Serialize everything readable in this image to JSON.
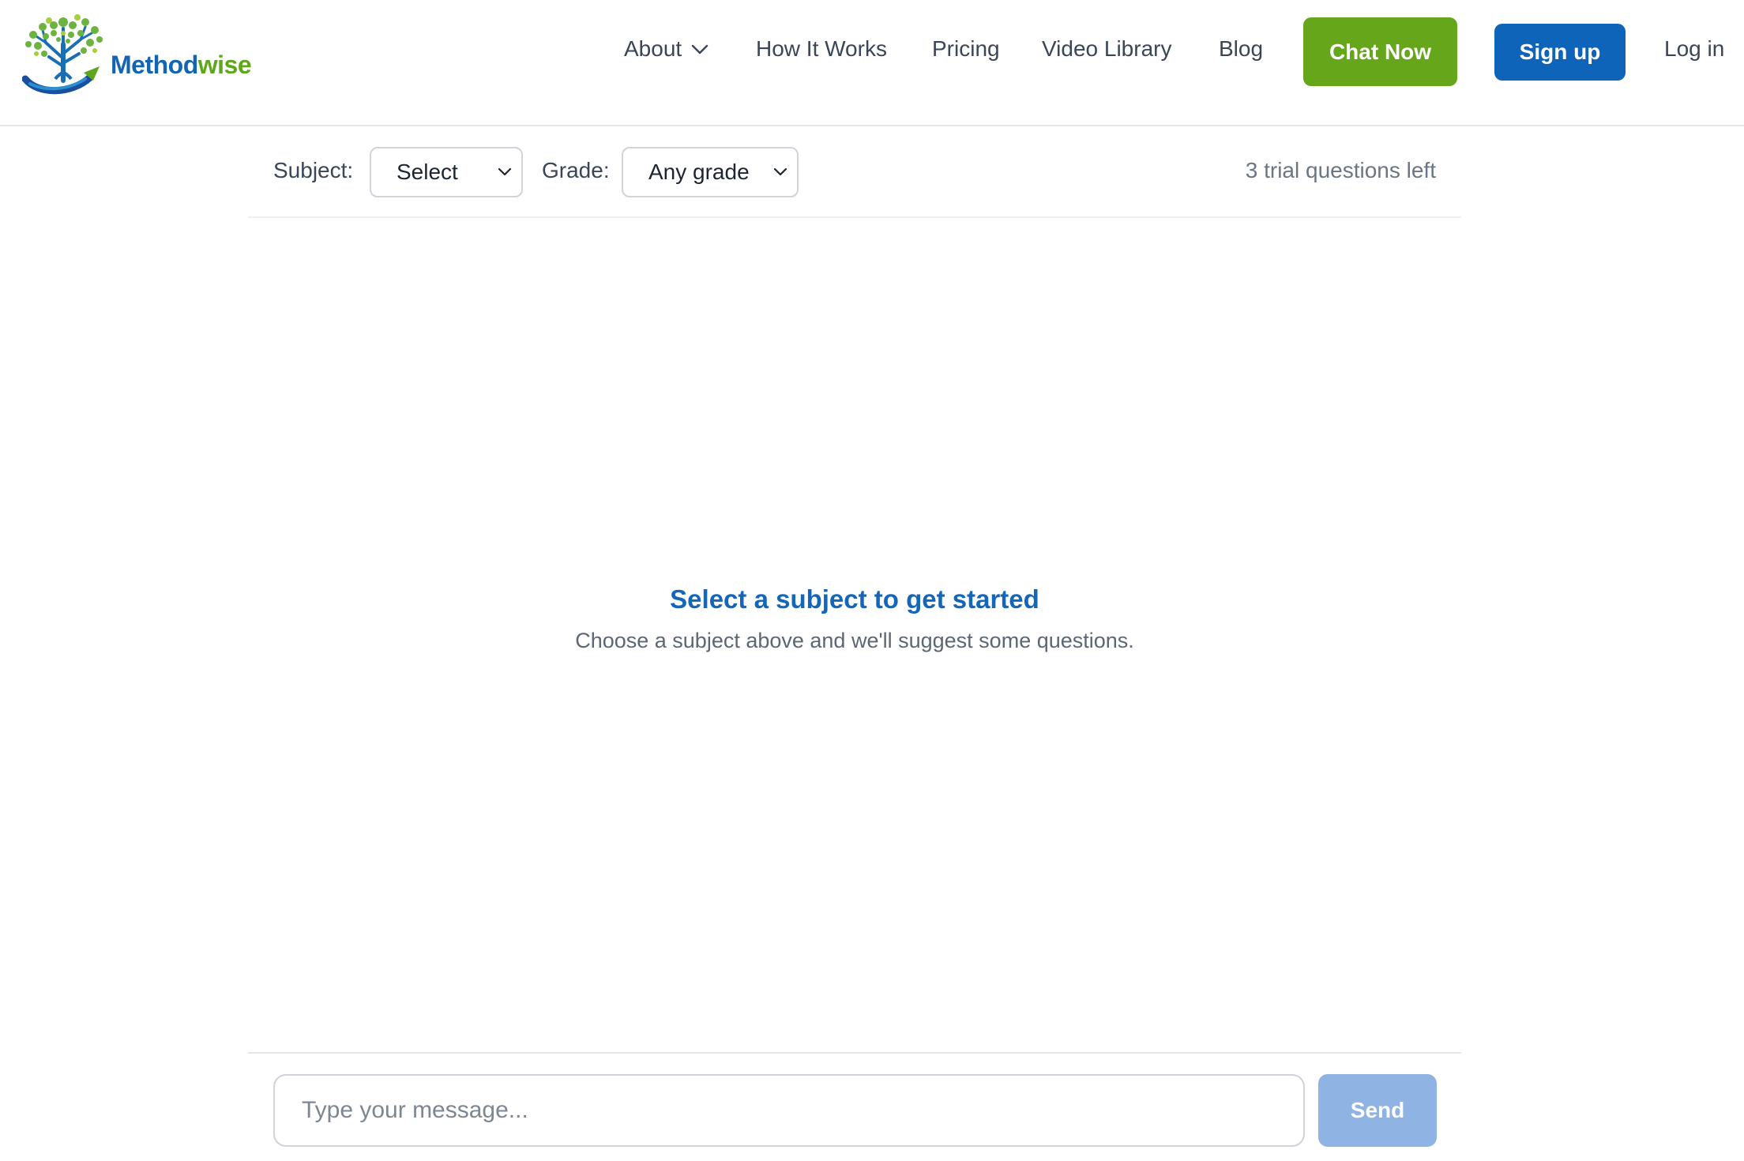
{
  "brand": {
    "name_part1": "Method",
    "name_part2": "wise",
    "colors": {
      "blue": "#1464b4",
      "green": "#5ea71c"
    }
  },
  "nav": {
    "about": "About",
    "how_it_works": "How It Works",
    "pricing": "Pricing",
    "video_library": "Video Library",
    "blog": "Blog",
    "chat_now": "Chat Now",
    "sign_up": "Sign up",
    "log_in": "Log in"
  },
  "filters": {
    "subject_label": "Subject:",
    "subject_value": "Select",
    "grade_label": "Grade:",
    "grade_value": "Any grade",
    "trial_status": "3 trial questions left"
  },
  "empty_state": {
    "title": "Select a subject to get started",
    "subtitle": "Choose a subject above and we'll suggest some questions."
  },
  "composer": {
    "placeholder": "Type your message...",
    "send_label": "Send"
  },
  "colors": {
    "chat_now_bg": "#65a61b",
    "sign_up_bg": "#0e64b9",
    "send_bg_disabled": "#8fb3e2",
    "empty_title": "#1466b8"
  }
}
